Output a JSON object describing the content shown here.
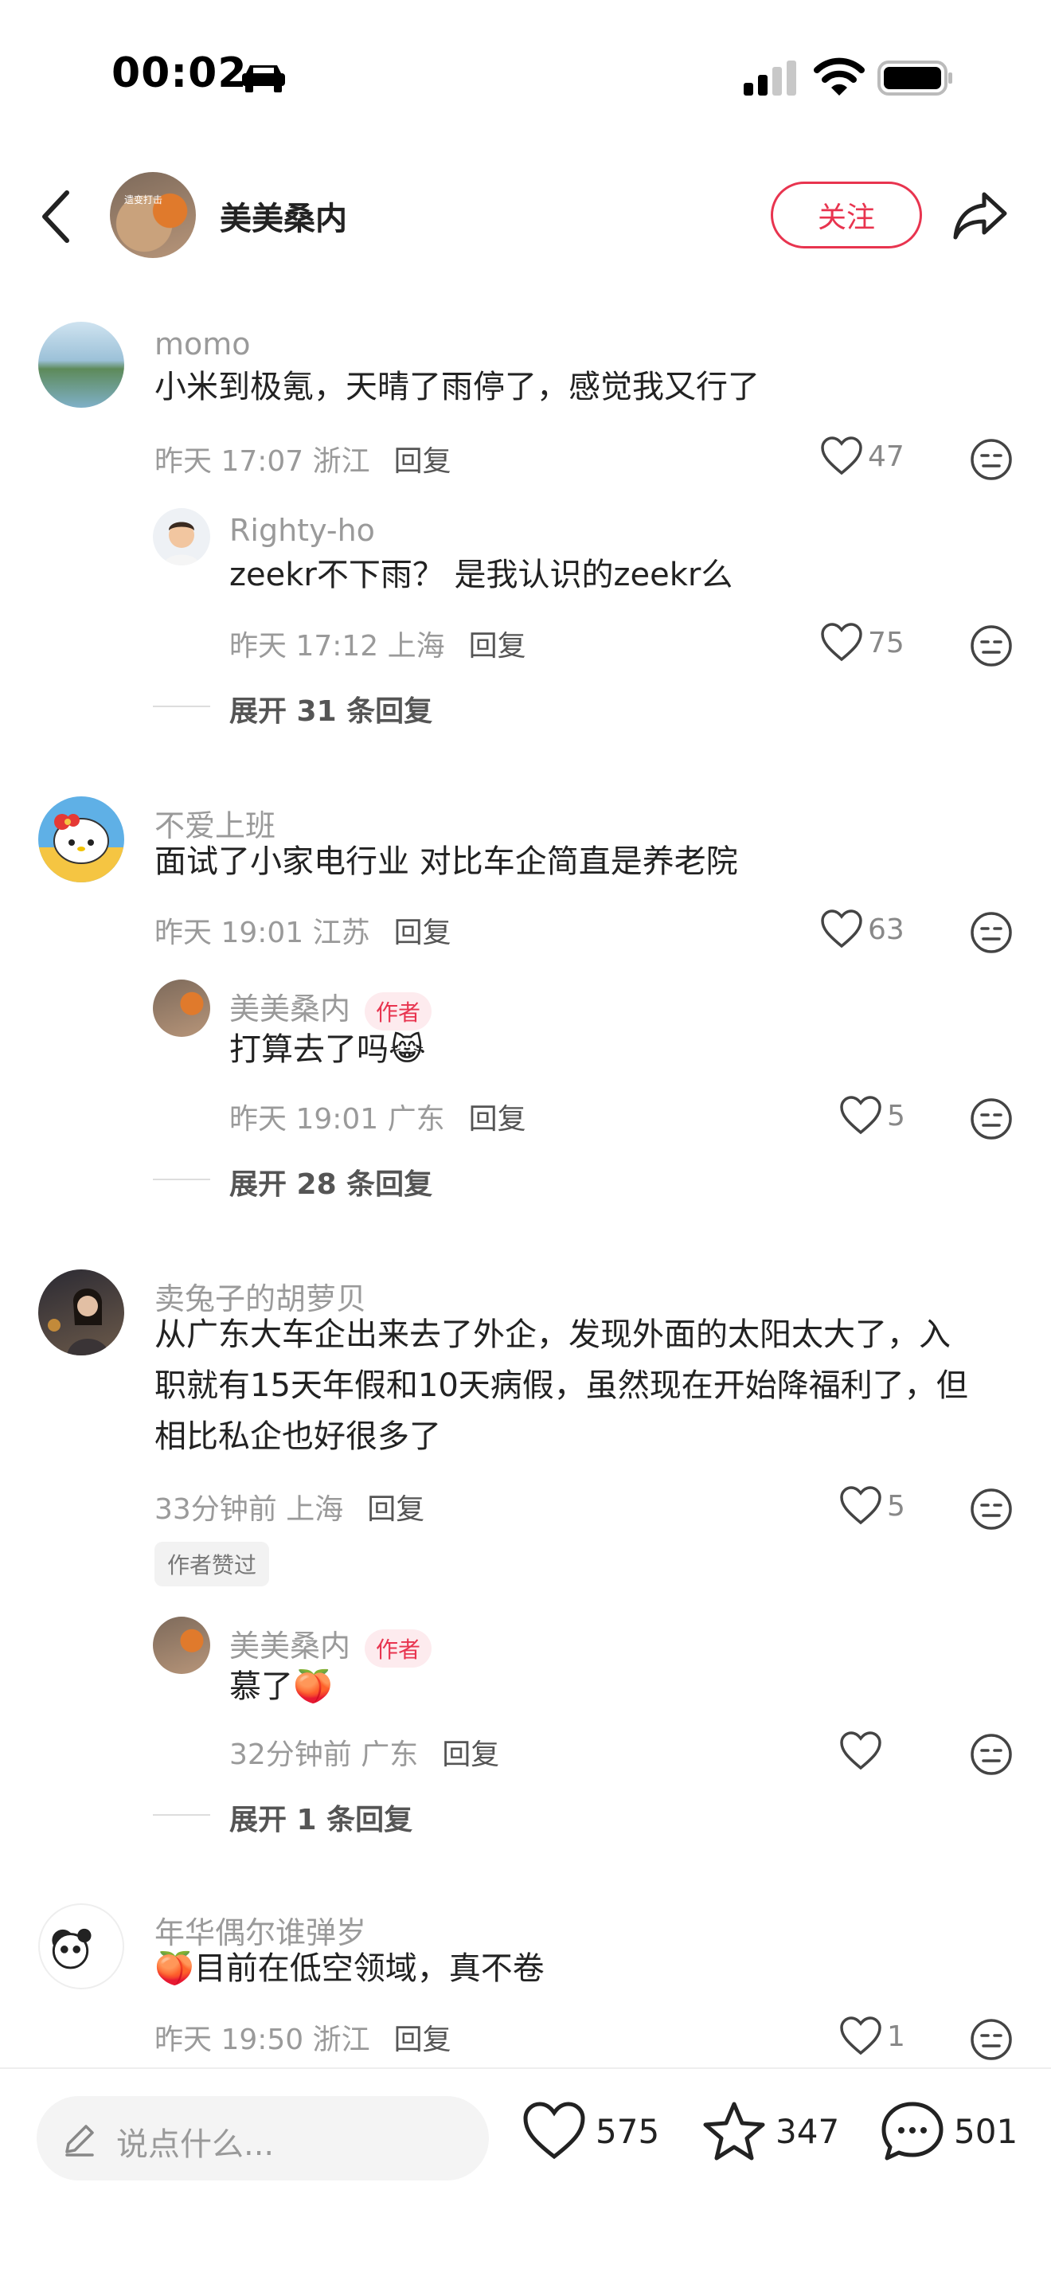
{
  "status_bar": {
    "time": "00:02"
  },
  "header": {
    "name": "美美桑内",
    "avatar_text": "遗变打击",
    "follow_label": "关注"
  },
  "comments": [
    {
      "name": "momo",
      "text": "小米到极氪，天晴了雨停了，感觉我又行了",
      "time": "昨天 17:07 浙江",
      "reply": "回复",
      "likes": "47",
      "replies": [
        {
          "name": "Righty-ho",
          "text": "zeekr不下雨？ 是我认识的zeekr么",
          "time": "昨天 17:12 上海",
          "reply": "回复",
          "likes": "75"
        }
      ],
      "expand": "展开 31 条回复"
    },
    {
      "name": "不爱上班",
      "text": "面试了小家电行业 对比车企简直是养老院",
      "time": "昨天 19:01 江苏",
      "reply": "回复",
      "likes": "63",
      "replies": [
        {
          "name": "美美桑内",
          "tag": "作者",
          "text": "打算去了吗😹",
          "time": "昨天 19:01 广东",
          "reply": "回复",
          "likes": "5"
        }
      ],
      "expand": "展开 28 条回复"
    },
    {
      "name": "卖兔子的胡萝贝",
      "text_lines": [
        "从广东大车企出来去了外企，发现外面的太阳太大了，入",
        "职就有15天年假和10天病假，虽然现在开始降福利了，但",
        "相比私企也好很多了"
      ],
      "time": "33分钟前 上海",
      "reply": "回复",
      "likes": "5",
      "liked_tag": "作者赞过",
      "replies": [
        {
          "name": "美美桑内",
          "tag": "作者",
          "text": "慕了🍑",
          "time": "32分钟前 广东",
          "reply": "回复",
          "likes": ""
        }
      ],
      "expand": "展开 1 条回复"
    },
    {
      "name": "年华偶尔谁弹岁",
      "text": "🍑目前在低空领域，真不卷",
      "time": "昨天 19:50 浙江",
      "reply": "回复",
      "likes": "1"
    }
  ],
  "bottom_bar": {
    "placeholder": "说点什么...",
    "likes": "575",
    "stars": "347",
    "comments": "501"
  },
  "colors": {
    "accent": "#e8344f",
    "muted": "#9a9a9a"
  }
}
